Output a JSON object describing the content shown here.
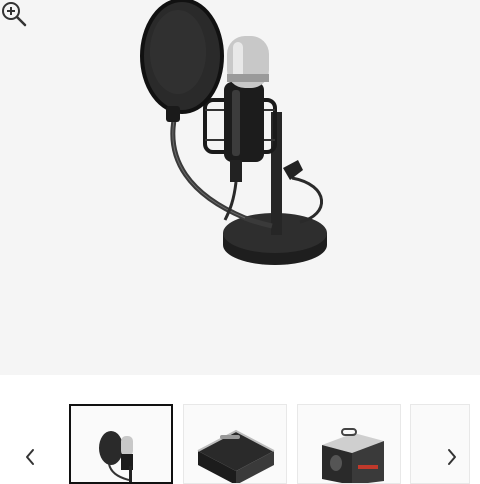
{
  "gallery": {
    "main_image": {
      "icon": "microphone-with-pop-filter-image"
    },
    "zoom": {
      "icon": "zoom-in-icon"
    },
    "prev": {
      "icon": "chevron-left-icon"
    },
    "next": {
      "icon": "chevron-right-icon"
    },
    "thumbnails": [
      {
        "icon": "microphone-thumbnail",
        "selected": true
      },
      {
        "icon": "carry-case-thumbnail",
        "selected": false
      },
      {
        "icon": "product-box-thumbnail",
        "selected": false
      },
      {
        "icon": "partial-thumbnail",
        "selected": false
      }
    ]
  },
  "colors": {
    "background": "#f5f5f5",
    "selected_border": "#111111"
  }
}
